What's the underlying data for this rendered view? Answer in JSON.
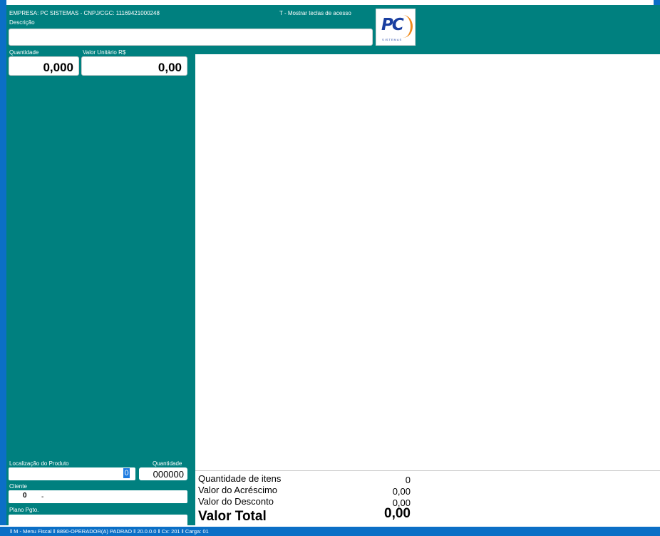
{
  "header": {
    "company": "EMPRESA: PC SISTEMAS  -  CNPJ/CGC: 11169421000248",
    "shortcut_hint": "T - Mostrar teclas de acesso",
    "description_label": "Descrição",
    "logo_text": "PC",
    "logo_sub": "SISTEMAS"
  },
  "entry": {
    "quantity_label": "Quantidade",
    "quantity_value": "0,000",
    "unit_value_label": "Valor Unitário R$",
    "unit_value": "0,00"
  },
  "product": {
    "location_label": "Localização do Produto",
    "location_value": "0",
    "quantity_label": "Quantidade",
    "quantity_value": "000000"
  },
  "customer": {
    "label": "Cliente",
    "code": "0",
    "name": "-"
  },
  "payment": {
    "label": "Plano Pgto."
  },
  "summary": {
    "items_label": "Quantidade de itens",
    "items_value": "0",
    "surcharge_label": "Valor do Acréscimo",
    "surcharge_value": "0,00",
    "discount_label": "Valor do Desconto",
    "discount_value": "0,00",
    "total_label": "Valor Total",
    "total_value": "0,00"
  },
  "status_bar": "‖  M - Menu Fiscal  ‖  8890-OPERADOR(A) PADRAO  ‖  20.0.0.0  ‖  Cx: 201  ‖  Carga: 01",
  "colors": {
    "teal": "#00807f",
    "blue": "#0b6fc6"
  }
}
